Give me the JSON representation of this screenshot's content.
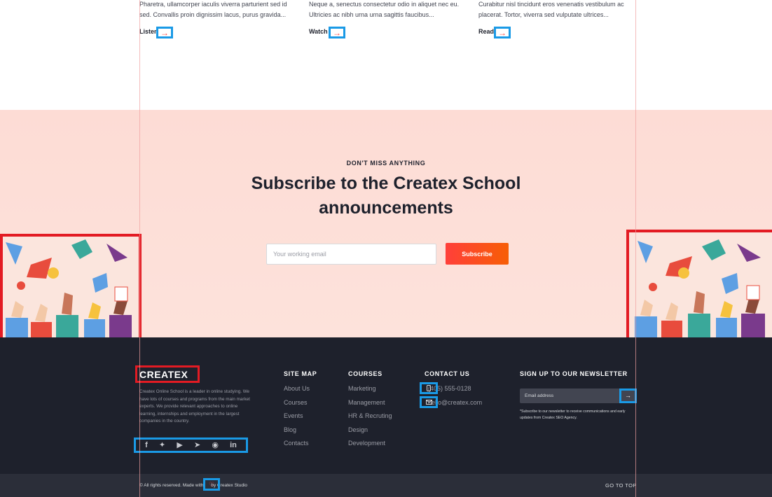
{
  "cards": [
    {
      "text_line1": "Pharetra, ullamcorper iaculis viverra parturient sed id",
      "text_line2": "sed. Convallis proin dignissim lacus, purus gravida...",
      "link": "Listen"
    },
    {
      "text_line1": "Neque a, senectus consectetur odio in aliquet nec eu.",
      "text_line2": "Ultricies ac nibh urna urna sagittis faucibus...",
      "link": "Watch"
    },
    {
      "text_line1": "Curabitur nisl tincidunt eros venenatis vestibulum ac",
      "text_line2": "placerat. Tortor, viverra sed vulputate ultrices...",
      "link": "Read"
    }
  ],
  "arrow_icon": "→",
  "subscribe": {
    "eyebrow": "DON'T MISS ANYTHING",
    "title_line1": "Subscribe to the Createx School",
    "title_line2": "announcements",
    "email_placeholder": "Your working email",
    "button": "Subscribe"
  },
  "footer": {
    "logo": "CREATEX",
    "about": "Createx Online School is a leader in online studying. We have lots of courses and programs from the main market experts. We provide relevant approaches to online learning, internships and employment in the largest companies in the country.",
    "social_icons": [
      "facebook-icon",
      "twitter-icon",
      "youtube-icon",
      "telegram-icon",
      "instagram-icon",
      "linkedin-icon"
    ],
    "site_map": {
      "title": "SITE MAP",
      "items": [
        "About Us",
        "Courses",
        "Events",
        "Blog",
        "Contacts"
      ]
    },
    "courses": {
      "title": "COURSES",
      "items": [
        "Marketing",
        "Management",
        "HR & Recruting",
        "Design",
        "Development"
      ]
    },
    "contact": {
      "title": "CONTACT US",
      "phone": "(405) 555-0128",
      "email": "hello@createx.com"
    },
    "newsletter": {
      "title": "SIGN UP TO OUR NEWSLETTER",
      "placeholder": "Email address",
      "note": "*Subscribe to our newsletter to receive communications and early updates from Createx SEO Agency."
    }
  },
  "bottom": {
    "copyright_prefix": "© All rights reserved. Made with",
    "copyright_suffix": "by Createx Studio",
    "go_to_top": "GO TO TOP"
  },
  "colors": {
    "accent": "#ff3f3a",
    "dark": "#1e212c",
    "highlight_blue": "#1a9ae6",
    "highlight_red": "#e31b23"
  }
}
